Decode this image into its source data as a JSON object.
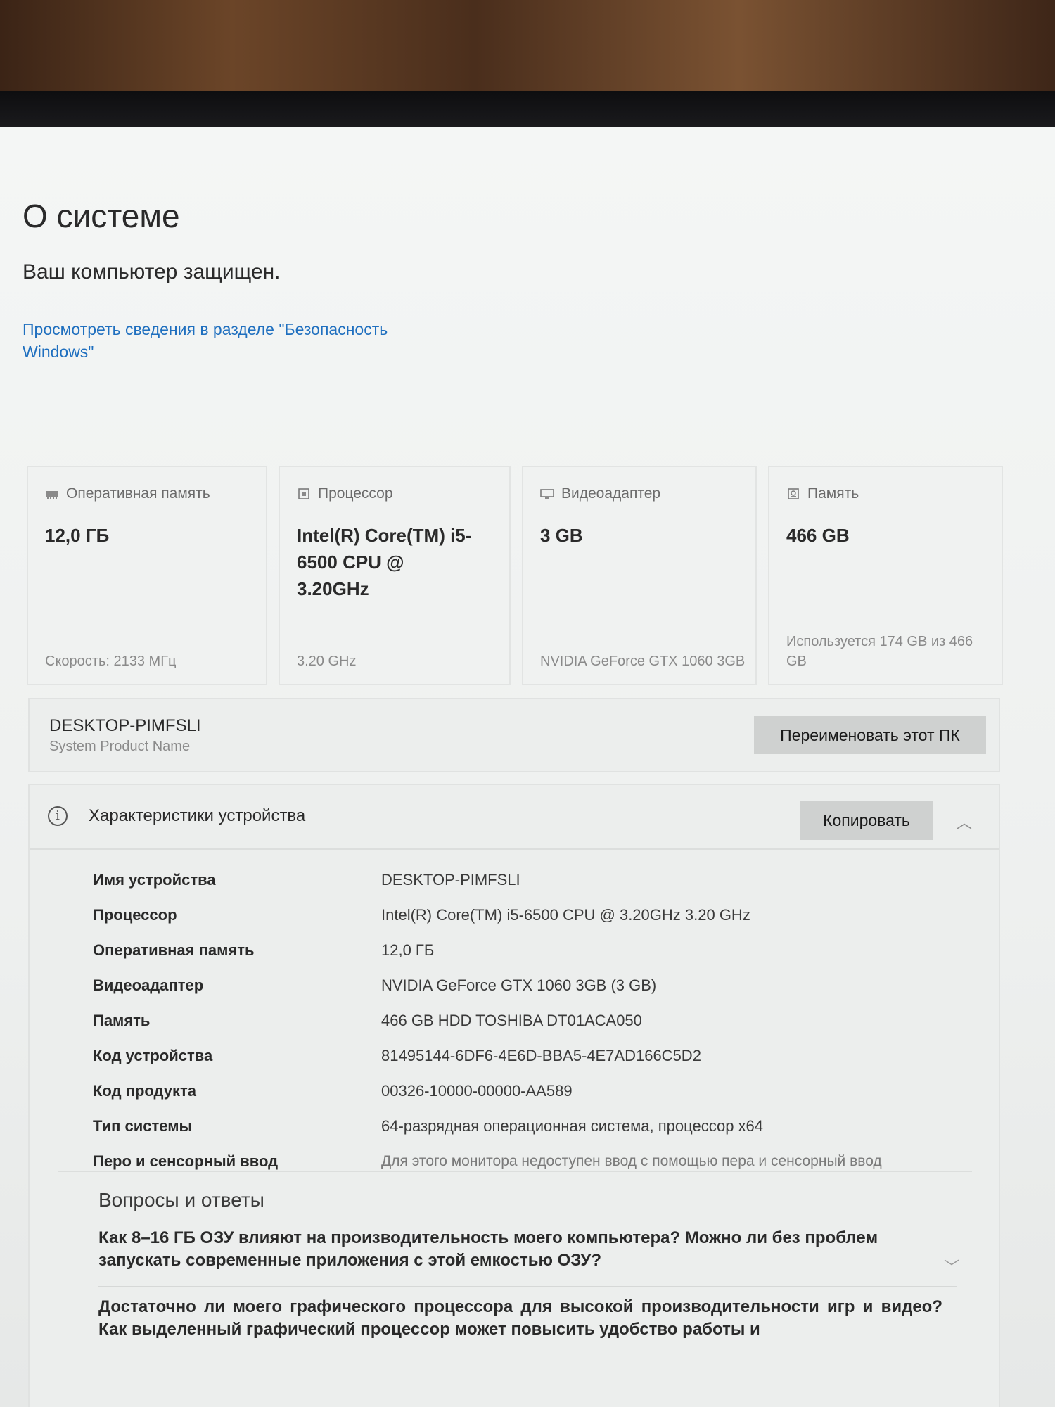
{
  "page": {
    "title": "О системе",
    "protection_status": "Ваш компьютер защищен.",
    "security_link": "Просмотреть сведения в разделе \"Безопасность Windows\""
  },
  "cards": [
    {
      "icon": "ram-icon",
      "label": "Оперативная память",
      "value": "12,0 ГБ",
      "footer": "Скорость: 2133 МГц"
    },
    {
      "icon": "cpu-icon",
      "label": "Процессор",
      "value": "Intel(R) Core(TM) i5-6500 CPU @ 3.20GHz",
      "footer": "3.20 GHz"
    },
    {
      "icon": "monitor-icon",
      "label": "Видеоадаптер",
      "value": "3 GB",
      "footer": "NVIDIA GeForce GTX 1060 3GB"
    },
    {
      "icon": "drive-icon",
      "label": "Память",
      "value": "466 GB",
      "footer": "Используется 174 GB из 466 GB"
    }
  ],
  "rename": {
    "device_name": "DESKTOP-PIMFSLI",
    "subtitle": "System Product Name",
    "button": "Переименовать этот ПК"
  },
  "specs": {
    "title": "Характеристики устройства",
    "copy_button": "Копировать",
    "rows": [
      {
        "label": "Имя устройства",
        "value": "DESKTOP-PIMFSLI"
      },
      {
        "label": "Процессор",
        "value": "Intel(R) Core(TM) i5-6500 CPU @ 3.20GHz   3.20 GHz"
      },
      {
        "label": "Оперативная память",
        "value": "12,0 ГБ"
      },
      {
        "label": "Видеоадаптер",
        "value": "NVIDIA GeForce GTX 1060 3GB (3 GB)"
      },
      {
        "label": "Память",
        "value": "466 GB HDD TOSHIBA DT01ACA050"
      },
      {
        "label": "Код устройства",
        "value": "81495144-6DF6-4E6D-BBA5-4E7AD166C5D2"
      },
      {
        "label": "Код продукта",
        "value": "00326-10000-00000-AA589"
      },
      {
        "label": "Тип системы",
        "value": "64-разрядная операционная система, процессор x64"
      },
      {
        "label": "Перо и сенсорный ввод",
        "value": "Для этого монитора недоступен ввод с помощью пера и сенсорный ввод"
      }
    ]
  },
  "faq": {
    "title": "Вопросы и ответы",
    "q1": "Как 8–16 ГБ ОЗУ влияют на производительность моего компьютера? Можно ли без проблем запускать современные приложения с этой емкостью ОЗУ?",
    "q2": "Достаточно ли моего графического процессора для высокой производительности игр и видео? Как выделенный графический процессор может повысить удобство работы и"
  }
}
